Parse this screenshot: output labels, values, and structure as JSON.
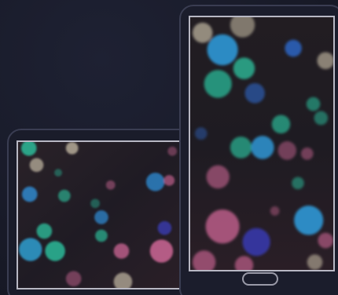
{
  "scene": {
    "background": "#181a28",
    "device_frame_color": "#3a3d52",
    "screen_border_color": "#b8b8c4",
    "palette": {
      "blue": "#2f8fd8",
      "teal": "#2bc4a0",
      "pink": "#d86b9c",
      "cream": "#f1e6c8",
      "dark": "#231d26"
    }
  },
  "devices": {
    "tablet": {
      "icon": "tablet-icon",
      "content": "bokeh-lights-image"
    },
    "phone": {
      "icon": "phone-icon",
      "content": "bokeh-lights-image",
      "home_button": "home-button"
    }
  }
}
